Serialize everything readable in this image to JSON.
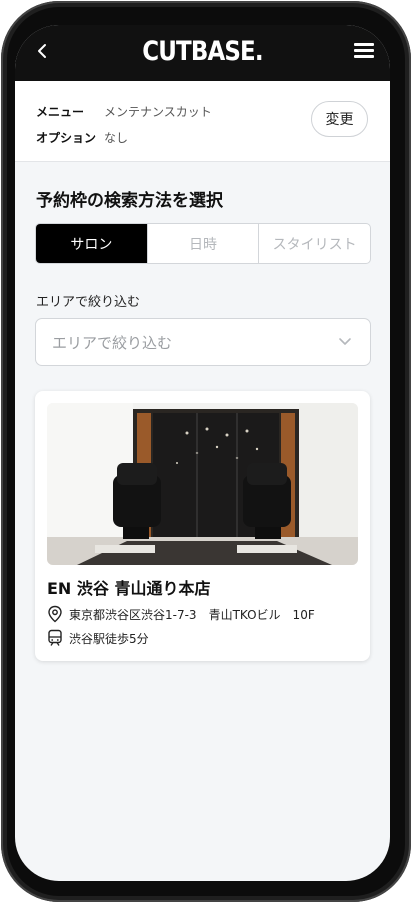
{
  "header": {
    "brand": "CUTBASE.",
    "back_icon": "chevron-left-icon",
    "menu_icon": "hamburger-menu-icon"
  },
  "summary": {
    "menu_label": "メニュー",
    "menu_value": "メンテナンスカット",
    "option_label": "オプション",
    "option_value": "なし",
    "change_button": "変更"
  },
  "search": {
    "title": "予約枠の検索方法を選択",
    "tabs": [
      {
        "label": "サロン",
        "active": true
      },
      {
        "label": "日時",
        "active": false
      },
      {
        "label": "スタイリスト",
        "active": false
      }
    ]
  },
  "area_filter": {
    "label": "エリアで絞り込む",
    "placeholder": "エリアで絞り込む"
  },
  "salon": {
    "name": "EN 渋谷 青山通り本店",
    "address": "東京都渋谷区渋谷1-7-3　青山TKOビル　10F",
    "access": "渋谷駅徒歩5分",
    "address_icon": "map-pin-icon",
    "access_icon": "train-icon"
  },
  "colors": {
    "accent": "#000000",
    "background": "#f4f6f8",
    "header": "#111111"
  }
}
